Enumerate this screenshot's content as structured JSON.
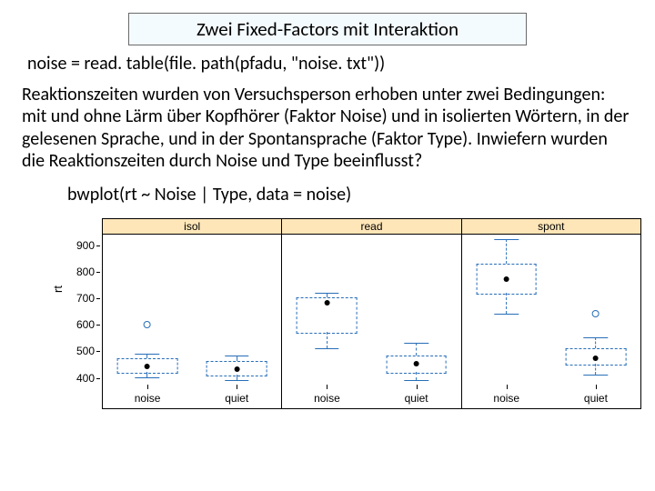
{
  "title": "Zwei Fixed-Factors mit Interaktion",
  "code_line1": "noise = read. table(file. path(pfadu, \"noise. txt\"))",
  "body_text": "Reaktionszeiten wurden von Versuchsperson erhoben unter zwei Bedingungen: mit und ohne Lärm über Kopfhörer (Faktor Noise) und in isolierten Wörtern, in der gelesenen Sprache, und in der Spontansprache (Faktor Type). Inwiefern wurden die Reaktionszeiten durch Noise und Type beeinflusst?",
  "code_line2": "bwplot(rt ~ Noise | Type, data = noise)",
  "chart_data": {
    "type": "box",
    "ylabel": "rt",
    "ylim": [
      400,
      950
    ],
    "yticks": [
      400,
      500,
      600,
      700,
      800,
      900
    ],
    "x_categories": [
      "noise",
      "quiet"
    ],
    "panels": [
      {
        "label": "isol",
        "boxes": [
          {
            "x": "noise",
            "min": 420,
            "q1": 440,
            "median": 460,
            "q3": 490,
            "max": 510,
            "outliers": [
              620
            ]
          },
          {
            "x": "quiet",
            "min": 410,
            "q1": 430,
            "median": 450,
            "q3": 480,
            "max": 500,
            "outliers": []
          }
        ]
      },
      {
        "label": "read",
        "boxes": [
          {
            "x": "noise",
            "min": 530,
            "q1": 590,
            "median": 700,
            "q3": 720,
            "max": 740,
            "outliers": []
          },
          {
            "x": "quiet",
            "min": 410,
            "q1": 440,
            "median": 470,
            "q3": 500,
            "max": 550,
            "outliers": []
          }
        ]
      },
      {
        "label": "spont",
        "boxes": [
          {
            "x": "noise",
            "min": 660,
            "q1": 740,
            "median": 790,
            "q3": 850,
            "max": 940,
            "outliers": []
          },
          {
            "x": "quiet",
            "min": 430,
            "q1": 470,
            "median": 490,
            "q3": 530,
            "max": 570,
            "outliers": [
              660
            ]
          }
        ]
      }
    ]
  }
}
